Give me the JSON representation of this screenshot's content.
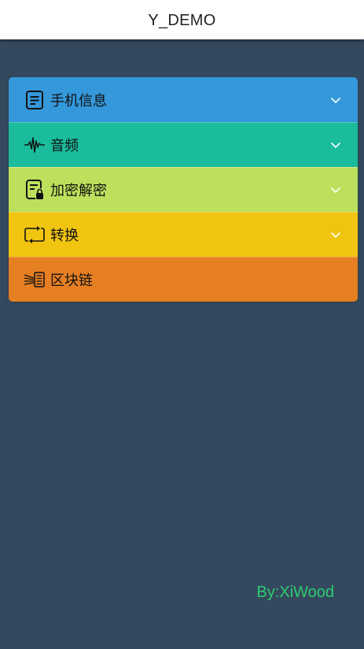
{
  "header": {
    "title": "Y_DEMO",
    "background": "#ffffff"
  },
  "page": {
    "background": "#34495e"
  },
  "menu": {
    "items": [
      {
        "label": "手机信息",
        "icon": "document-list-icon",
        "color": "#3498db",
        "expandable": true
      },
      {
        "label": "音频",
        "icon": "waveform-icon",
        "color": "#1abc9c",
        "expandable": true
      },
      {
        "label": "加密解密",
        "icon": "document-lock-icon",
        "color": "#bde05c",
        "expandable": true
      },
      {
        "label": "转换",
        "icon": "convert-arrows-icon",
        "color": "#f1c40f",
        "expandable": true
      },
      {
        "label": "区块链",
        "icon": "blockchain-icon",
        "color": "#e67e22",
        "expandable": false
      }
    ]
  },
  "footer": {
    "credit": "By:XiWood",
    "color": "#2ecc71"
  }
}
